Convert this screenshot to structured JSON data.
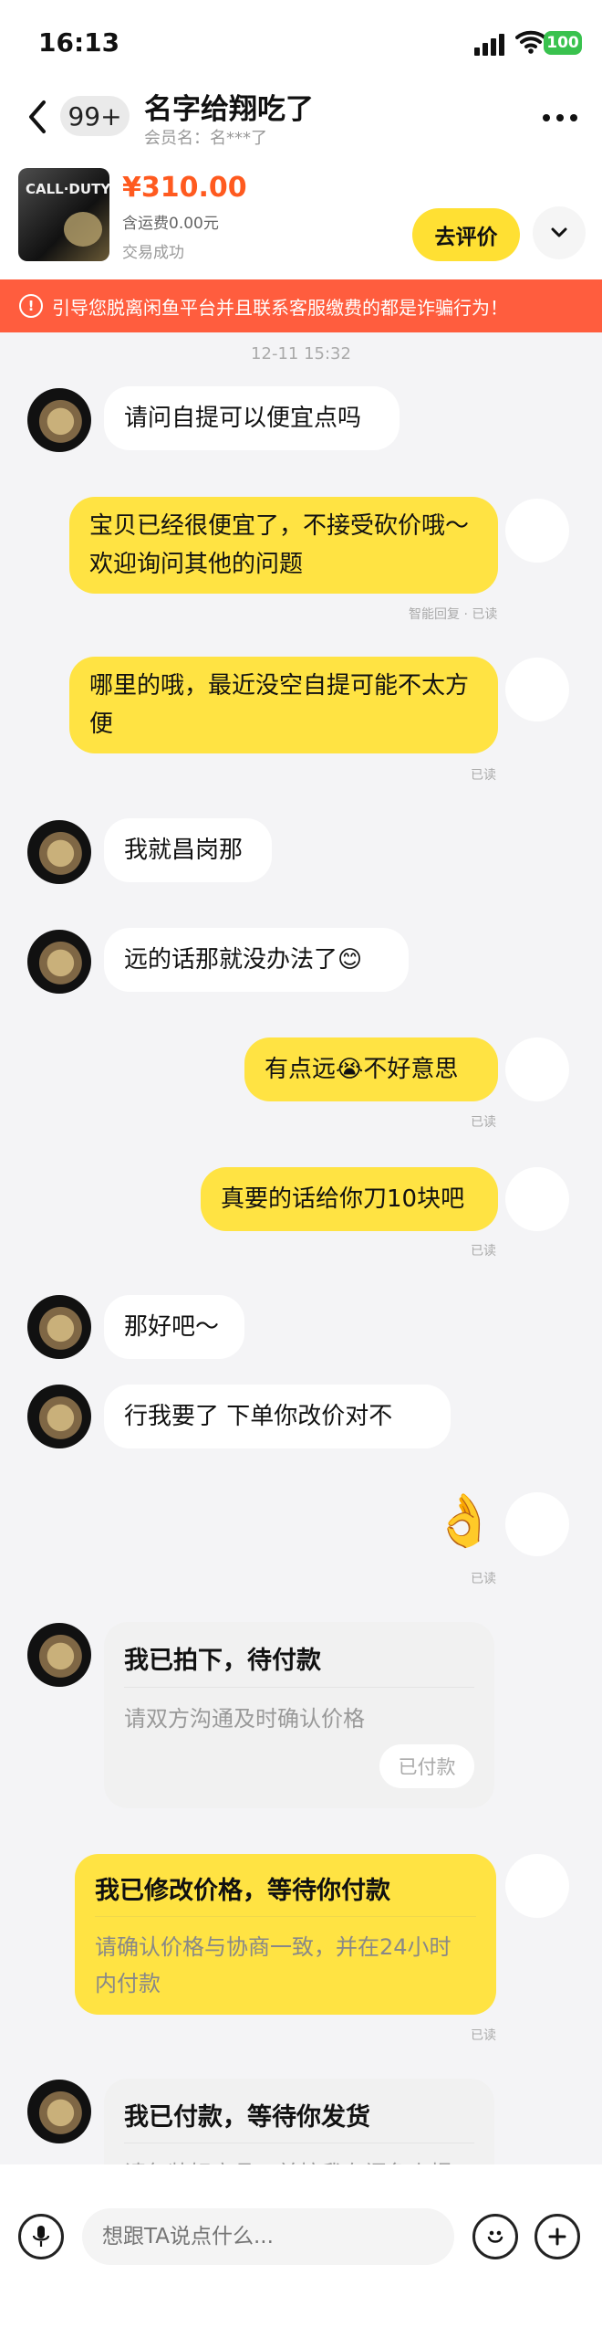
{
  "status_bar": {
    "time": "16:13",
    "battery": "100"
  },
  "header": {
    "badge": "99+",
    "title": "名字给翔吃了",
    "subtitle": "会员名：名***了"
  },
  "product": {
    "price": "¥310.00",
    "shipping": "含运费0.00元",
    "status": "交易成功",
    "review_button": "去评价",
    "image_text": "CALL·DUTY"
  },
  "warning": {
    "text": "引导您脱离闲鱼平台并且联系客服缴费的都是诈骗行为！"
  },
  "chat": {
    "timestamp": "12-11 15:32",
    "messages": [
      {
        "text": "请问自提可以便宜点吗"
      },
      {
        "text": "宝贝已经很便宜了，不接受砍价哦～欢迎询问其他的问题",
        "meta": "智能回复 · 已读"
      },
      {
        "text": "哪里的哦，最近没空自提可能不太方便",
        "meta": "已读"
      },
      {
        "text": "我就昌岗那"
      },
      {
        "text": "远的话那就没办法了😊"
      },
      {
        "text": "有点远😭不好意思",
        "meta": "已读"
      },
      {
        "text": "真要的话给你刀10块吧",
        "meta": "已读"
      },
      {
        "text": "那好吧～"
      },
      {
        "text": "行我要了   下单你改价对不"
      },
      {
        "text": "👌",
        "meta": "已读"
      }
    ],
    "cards": [
      {
        "title": "我已拍下，待付款",
        "text": "请双方沟通及时确认价格",
        "button": "已付款"
      },
      {
        "title": "我已修改价格，等待你付款",
        "text": "请确认价格与协商一致，并在24小时内付款",
        "meta": "已读"
      },
      {
        "title": "我已付款，等待你发货",
        "text": "请包装好商品，并按我在闲鱼上提"
      }
    ]
  },
  "input": {
    "placeholder": "想跟TA说点什么..."
  },
  "colors": {
    "accent_yellow": "#ffe343",
    "warning_red": "#ff5d3e",
    "price_orange": "#ff5a1f"
  }
}
